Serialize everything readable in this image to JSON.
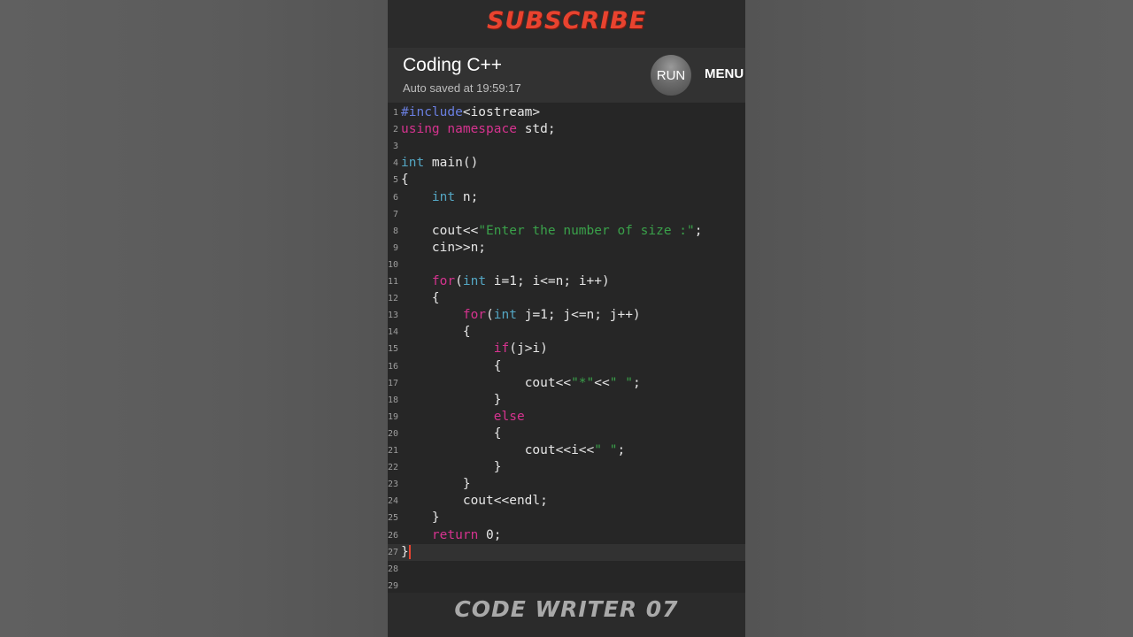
{
  "banner": {
    "subscribe": "SUBSCRIBE"
  },
  "app": {
    "title": "Coding C++",
    "subtitle": "Auto saved at 19:59:17",
    "run_label": "RUN",
    "menu_label": "MENU"
  },
  "editor": {
    "active_line": 27,
    "lines": [
      {
        "n": "1",
        "indent": "",
        "tokens": [
          [
            "pp",
            "#include"
          ],
          [
            "plain",
            "<iostream>"
          ]
        ]
      },
      {
        "n": "2",
        "indent": "",
        "tokens": [
          [
            "kw",
            "using"
          ],
          [
            "plain",
            " "
          ],
          [
            "kw",
            "namespace"
          ],
          [
            "plain",
            " std;"
          ]
        ]
      },
      {
        "n": "3",
        "indent": "",
        "tokens": []
      },
      {
        "n": "4",
        "indent": "",
        "tokens": [
          [
            "ty",
            "int"
          ],
          [
            "plain",
            " main()"
          ]
        ]
      },
      {
        "n": "5",
        "indent": "",
        "tokens": [
          [
            "plain",
            "{"
          ]
        ]
      },
      {
        "n": "6",
        "indent": "    ",
        "tokens": [
          [
            "ty",
            "int"
          ],
          [
            "plain",
            " n;"
          ]
        ]
      },
      {
        "n": "7",
        "indent": "",
        "tokens": []
      },
      {
        "n": "8",
        "indent": "    ",
        "tokens": [
          [
            "plain",
            "cout<<"
          ],
          [
            "str",
            "\"Enter the number of size :\""
          ],
          [
            "plain",
            ";"
          ]
        ]
      },
      {
        "n": "9",
        "indent": "    ",
        "tokens": [
          [
            "plain",
            "cin>>n;"
          ]
        ]
      },
      {
        "n": "10",
        "indent": "",
        "tokens": []
      },
      {
        "n": "11",
        "indent": "    ",
        "tokens": [
          [
            "kw",
            "for"
          ],
          [
            "plain",
            "("
          ],
          [
            "ty",
            "int"
          ],
          [
            "plain",
            " i=1; i<=n; i++)"
          ]
        ]
      },
      {
        "n": "12",
        "indent": "    ",
        "tokens": [
          [
            "plain",
            "{"
          ]
        ]
      },
      {
        "n": "13",
        "indent": "        ",
        "tokens": [
          [
            "kw",
            "for"
          ],
          [
            "plain",
            "("
          ],
          [
            "ty",
            "int"
          ],
          [
            "plain",
            " j=1; j<=n; j++)"
          ]
        ]
      },
      {
        "n": "14",
        "indent": "        ",
        "tokens": [
          [
            "plain",
            "{"
          ]
        ]
      },
      {
        "n": "15",
        "indent": "            ",
        "tokens": [
          [
            "kw",
            "if"
          ],
          [
            "plain",
            "(j>i)"
          ]
        ]
      },
      {
        "n": "16",
        "indent": "            ",
        "tokens": [
          [
            "plain",
            "{"
          ]
        ]
      },
      {
        "n": "17",
        "indent": "                ",
        "tokens": [
          [
            "plain",
            "cout<<"
          ],
          [
            "str",
            "\"*\""
          ],
          [
            "plain",
            "<<"
          ],
          [
            "str",
            "\" \""
          ],
          [
            "plain",
            ";"
          ]
        ]
      },
      {
        "n": "18",
        "indent": "            ",
        "tokens": [
          [
            "plain",
            "}"
          ]
        ]
      },
      {
        "n": "19",
        "indent": "            ",
        "tokens": [
          [
            "kw",
            "else"
          ]
        ]
      },
      {
        "n": "20",
        "indent": "            ",
        "tokens": [
          [
            "plain",
            "{"
          ]
        ]
      },
      {
        "n": "21",
        "indent": "                ",
        "tokens": [
          [
            "plain",
            "cout<<i<<"
          ],
          [
            "str",
            "\" \""
          ],
          [
            "plain",
            ";"
          ]
        ]
      },
      {
        "n": "22",
        "indent": "            ",
        "tokens": [
          [
            "plain",
            "}"
          ]
        ]
      },
      {
        "n": "23",
        "indent": "        ",
        "tokens": [
          [
            "plain",
            "}"
          ]
        ]
      },
      {
        "n": "24",
        "indent": "        ",
        "tokens": [
          [
            "plain",
            "cout<<endl;"
          ]
        ]
      },
      {
        "n": "25",
        "indent": "    ",
        "tokens": [
          [
            "plain",
            "}"
          ]
        ]
      },
      {
        "n": "26",
        "indent": "    ",
        "tokens": [
          [
            "kw",
            "return"
          ],
          [
            "plain",
            " 0;"
          ]
        ]
      },
      {
        "n": "27",
        "indent": "",
        "tokens": [
          [
            "plain",
            "}"
          ]
        ]
      },
      {
        "n": "28",
        "indent": "",
        "tokens": []
      },
      {
        "n": "29",
        "indent": "",
        "tokens": []
      }
    ]
  },
  "watermark": "CODE WRITER 07",
  "colors": {
    "keyword": "#d6338f",
    "type": "#54a7c4",
    "string": "#3aa14a",
    "preprocessor": "#6a7fe0",
    "subscribe": "#e8432f"
  }
}
